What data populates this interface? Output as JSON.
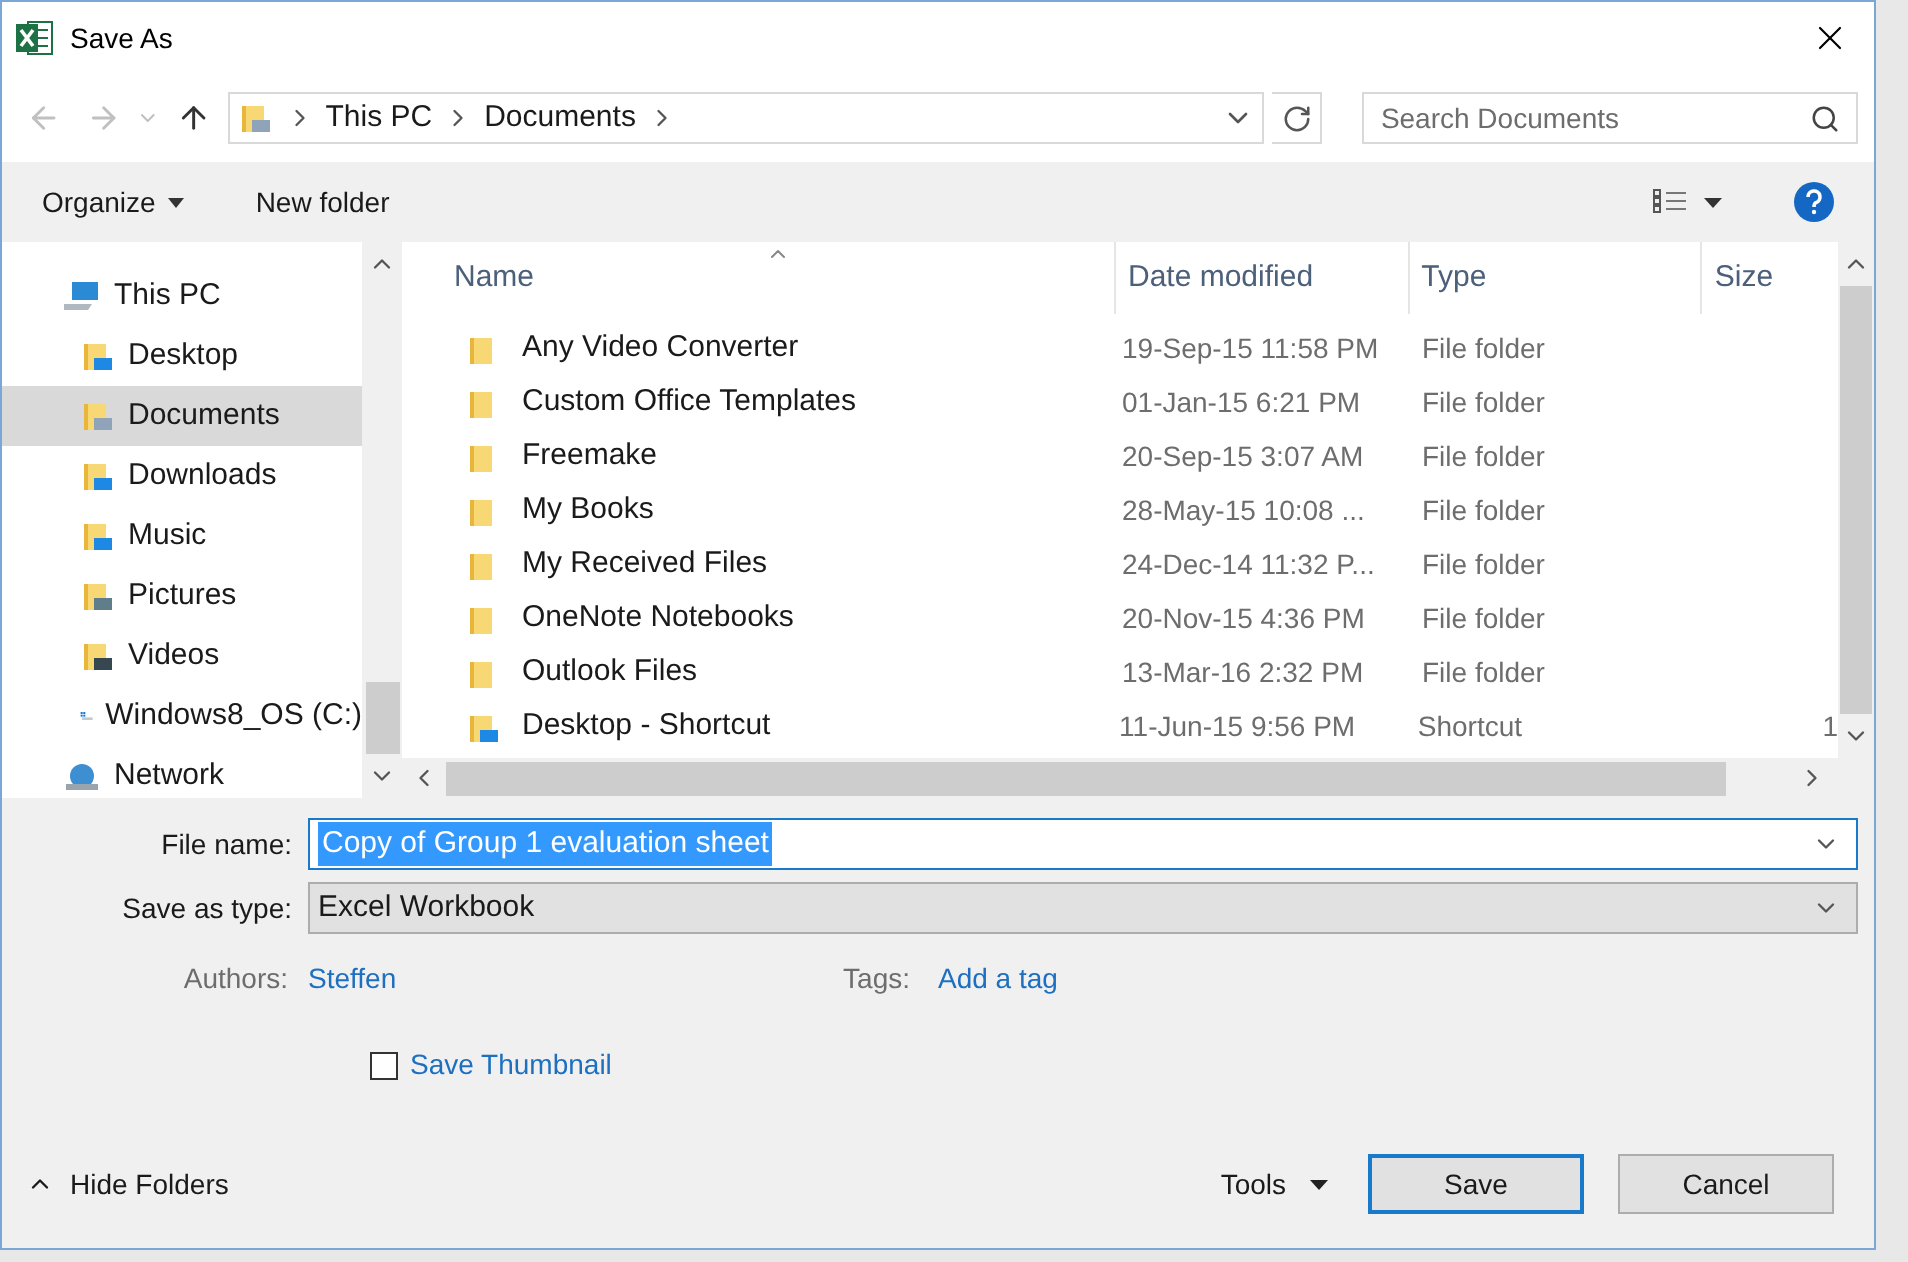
{
  "window": {
    "title": "Save As"
  },
  "nav": {
    "path": [
      "This PC",
      "Documents"
    ],
    "search_placeholder": "Search Documents"
  },
  "toolbar": {
    "organize": "Organize",
    "new_folder": "New folder"
  },
  "sidebar": {
    "items": [
      {
        "label": "This PC",
        "kind": "pc",
        "selected": false,
        "children": [
          {
            "label": "Desktop",
            "kind": "desktop",
            "selected": false
          },
          {
            "label": "Documents",
            "kind": "documents",
            "selected": true
          },
          {
            "label": "Downloads",
            "kind": "downloads",
            "selected": false
          },
          {
            "label": "Music",
            "kind": "music",
            "selected": false
          },
          {
            "label": "Pictures",
            "kind": "pictures",
            "selected": false
          },
          {
            "label": "Videos",
            "kind": "videos",
            "selected": false
          },
          {
            "label": "Windows8_OS (C:)",
            "kind": "drive",
            "selected": false
          }
        ]
      },
      {
        "label": "Network",
        "kind": "network",
        "selected": false
      }
    ]
  },
  "table": {
    "columns": [
      {
        "label": "Name",
        "sorted": true
      },
      {
        "label": "Date modified",
        "sorted": false
      },
      {
        "label": "Type",
        "sorted": false
      },
      {
        "label": "Size",
        "sorted": false
      }
    ],
    "rows": [
      {
        "name": "Any Video Converter",
        "date": "19-Sep-15 11:58 PM",
        "type": "File folder",
        "kind": "folder"
      },
      {
        "name": "Custom Office Templates",
        "date": "01-Jan-15 6:21 PM",
        "type": "File folder",
        "kind": "folder"
      },
      {
        "name": "Freemake",
        "date": "20-Sep-15 3:07 AM",
        "type": "File folder",
        "kind": "folder"
      },
      {
        "name": "My Books",
        "date": "28-May-15 10:08 ...",
        "type": "File folder",
        "kind": "folder"
      },
      {
        "name": "My Received Files",
        "date": "24-Dec-14 11:32 P...",
        "type": "File folder",
        "kind": "folder"
      },
      {
        "name": "OneNote Notebooks",
        "date": "20-Nov-15 4:36 PM",
        "type": "File folder",
        "kind": "folder"
      },
      {
        "name": "Outlook Files",
        "date": "13-Mar-16 2:32 PM",
        "type": "File folder",
        "kind": "folder"
      },
      {
        "name": "Desktop - Shortcut",
        "date": "11-Jun-15 9:56 PM",
        "type": "Shortcut",
        "size": "1",
        "kind": "shortcut"
      }
    ]
  },
  "form": {
    "file_name": {
      "label": "File name:",
      "value": "Copy of Group 1 evaluation sheet"
    },
    "save_type": {
      "label": "Save as type:",
      "value": "Excel Workbook"
    },
    "authors": {
      "label": "Authors:",
      "value": "Steffen"
    },
    "tags": {
      "label": "Tags:",
      "value": "Add a tag"
    },
    "thumbnail": {
      "label": "Save Thumbnail",
      "checked": false
    }
  },
  "footer": {
    "hide_folders": "Hide Folders",
    "tools": "Tools",
    "save": "Save",
    "cancel": "Cancel"
  }
}
